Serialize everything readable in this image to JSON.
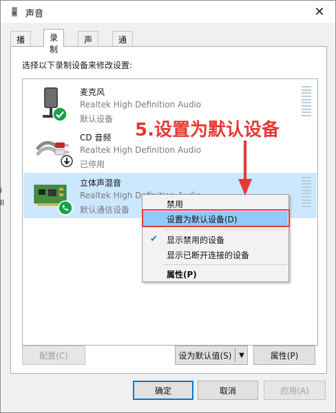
{
  "window": {
    "title": "声音",
    "close_glyph": "✕"
  },
  "tabs": [
    "播放",
    "录制",
    "声音",
    "通信"
  ],
  "active_tab": "录制",
  "instruction": "选择以下录制设备来修改设置:",
  "devices": [
    {
      "name": "麦克风",
      "driver": "Realtek High Definition Audio",
      "status": "默认设备",
      "icon": "microphone-icon",
      "badge": "green-check-icon"
    },
    {
      "name": "CD 音频",
      "driver": "Realtek High Definition Audio",
      "status": "已停用",
      "icon": "cd-audio-cable-icon",
      "badge": "down-arrow-disabled-icon"
    },
    {
      "name": "立体声混音",
      "driver": "Realtek High Definition Audio",
      "status": "默认通信设备",
      "icon": "sound-card-icon",
      "badge": "green-phone-icon"
    }
  ],
  "context_menu": {
    "items": [
      {
        "label": "禁用"
      },
      {
        "label": "设置为默认设备(D)",
        "highlighted": true
      },
      {
        "label": "显示禁用的设备",
        "checked": true
      },
      {
        "label": "显示已断开连接的设备"
      },
      {
        "label": "属性(P)",
        "bold": true
      }
    ]
  },
  "annotation": {
    "text": "5.设置为默认设备",
    "color": "#e53935"
  },
  "buttons": {
    "configure": "配置(C)",
    "set_default": "设为默认值(S)",
    "properties": "属性(P)",
    "ok": "确定",
    "cancel": "取消",
    "apply": "应用(A)"
  },
  "left_edge_fragments": [
    "i",
    "ll"
  ],
  "colors": {
    "selection": "#cce8ff",
    "menu_highlight": "#91c9f7",
    "accent": "#0078d7",
    "annotation_red": "#e53935",
    "check_green": "#17a34a"
  }
}
